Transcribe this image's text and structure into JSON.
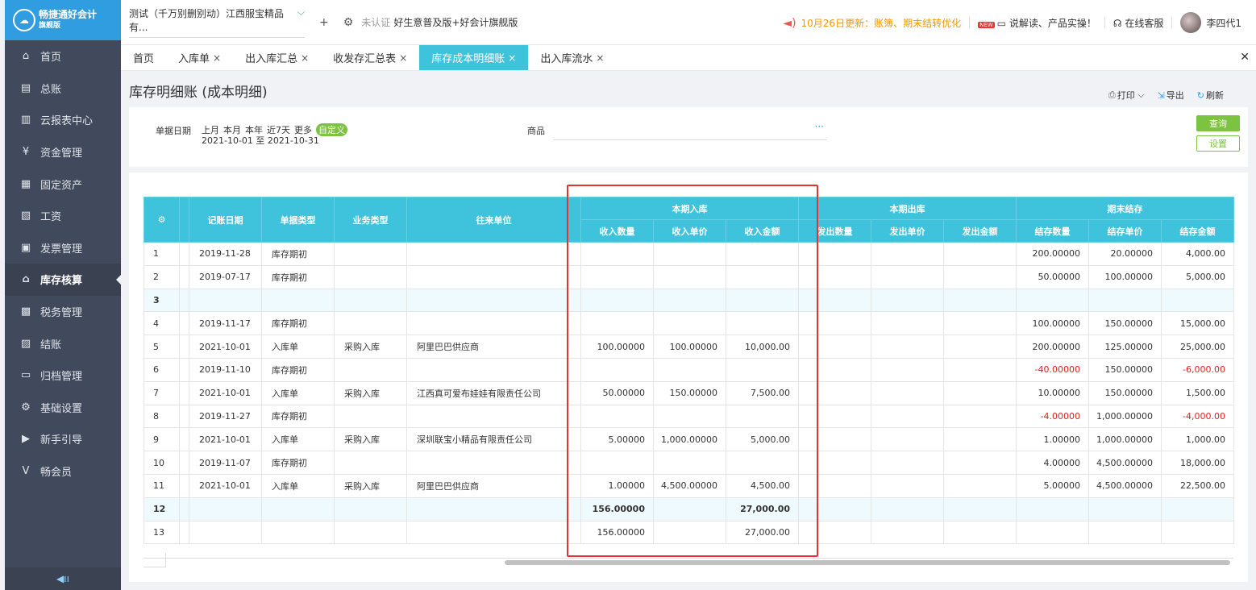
{
  "brand": {
    "name": "畅捷通好会计",
    "edition_badge": "旗舰版",
    "logo_glyph": "☁"
  },
  "sidebar": {
    "items": [
      {
        "label": "首页",
        "icon": "home-icon",
        "glyph": "⌂",
        "active": false
      },
      {
        "label": "总账",
        "icon": "ledger-icon",
        "glyph": "▤",
        "active": false
      },
      {
        "label": "云报表中心",
        "icon": "chart-icon",
        "glyph": "▥",
        "active": false
      },
      {
        "label": "资金管理",
        "icon": "money-icon",
        "glyph": "¥",
        "active": false
      },
      {
        "label": "固定资产",
        "icon": "asset-icon",
        "glyph": "▦",
        "active": false
      },
      {
        "label": "工资",
        "icon": "salary-icon",
        "glyph": "▧",
        "active": false
      },
      {
        "label": "发票管理",
        "icon": "invoice-icon",
        "glyph": "▣",
        "active": false
      },
      {
        "label": "库存核算",
        "icon": "warehouse-icon",
        "glyph": "⌂",
        "active": true
      },
      {
        "label": "税务管理",
        "icon": "tax-icon",
        "glyph": "▩",
        "active": false
      },
      {
        "label": "结账",
        "icon": "close-books-icon",
        "glyph": "▨",
        "active": false
      },
      {
        "label": "归档管理",
        "icon": "archive-icon",
        "glyph": "▭",
        "active": false
      },
      {
        "label": "基础设置",
        "icon": "gear-icon",
        "glyph": "⚙",
        "active": false
      },
      {
        "label": "新手引导",
        "icon": "guide-icon",
        "glyph": "▶",
        "active": false
      },
      {
        "label": "畅会员",
        "icon": "vip-icon",
        "glyph": "V",
        "active": false
      }
    ],
    "collapse_glyph": "◀ıı"
  },
  "topbar": {
    "company": "测试（千万别删别动）江西服宝精品有...",
    "company_chevron": "⌵",
    "add_glyph": "+",
    "settings_glyph": "⚙",
    "auth_status": "未认证",
    "edition": "好生意普及版+好会计旗舰版",
    "notice": "10月26日更新：账簿、期末结转优化",
    "tutorial_badge": "NEW",
    "tutorial": "说解读、产品实操！",
    "support": "在线客服",
    "user": "李四代1"
  },
  "tabs": [
    {
      "label": "首页",
      "closable": false,
      "active": false
    },
    {
      "label": "入库单",
      "closable": true,
      "active": false
    },
    {
      "label": "出入库汇总",
      "closable": true,
      "active": false
    },
    {
      "label": "收发存汇总表",
      "closable": true,
      "active": false
    },
    {
      "label": "库存成本明细账",
      "closable": true,
      "active": true
    },
    {
      "label": "出入库流水",
      "closable": true,
      "active": false
    }
  ],
  "page": {
    "title": "库存明细账 (成本明细)",
    "actions": {
      "print": "打印",
      "export": "导出",
      "refresh": "刷新"
    }
  },
  "filter": {
    "date_label": "单据日期",
    "quick_ranges": [
      "上月",
      "本月",
      "本年",
      "近7天",
      "更多"
    ],
    "custom_label": "自定义",
    "date_range": "2021-10-01 至 2021-10-31",
    "goods_label": "商品",
    "goods_value": "",
    "goods_more": "···",
    "query_button": "查询",
    "settings_button": "设置"
  },
  "table": {
    "settings_glyph": "⚙",
    "columns": {
      "date": "记账日期",
      "doc_type": "单据类型",
      "biz_type": "业务类型",
      "partner": "往来单位",
      "in_group": "本期入库",
      "out_group": "本期出库",
      "end_group": "期末结存",
      "in_qty": "收入数量",
      "in_price": "收入单价",
      "in_amount": "收入金额",
      "out_qty": "发出数量",
      "out_price": "发出单价",
      "out_amount": "发出金额",
      "end_qty": "结存数量",
      "end_price": "结存单价",
      "end_amount": "结存金额"
    },
    "rows": [
      {
        "idx": "1",
        "date": "2019-11-28",
        "doc_type": "库存期初",
        "biz_type": "",
        "partner": "",
        "in_qty": "",
        "in_price": "",
        "in_amount": "",
        "out_qty": "",
        "out_price": "",
        "out_amount": "",
        "end_qty": "200.00000",
        "end_price": "20.00000",
        "end_amount": "4,000.00",
        "negative": false,
        "highlight": false,
        "bold": false
      },
      {
        "idx": "2",
        "date": "2019-07-17",
        "doc_type": "库存期初",
        "biz_type": "",
        "partner": "",
        "in_qty": "",
        "in_price": "",
        "in_amount": "",
        "out_qty": "",
        "out_price": "",
        "out_amount": "",
        "end_qty": "50.00000",
        "end_price": "100.00000",
        "end_amount": "5,000.00",
        "negative": false,
        "highlight": false,
        "bold": false
      },
      {
        "idx": "3",
        "date": "",
        "doc_type": "",
        "biz_type": "",
        "partner": "",
        "in_qty": "",
        "in_price": "",
        "in_amount": "",
        "out_qty": "",
        "out_price": "",
        "out_amount": "",
        "end_qty": "",
        "end_price": "",
        "end_amount": "",
        "negative": false,
        "highlight": true,
        "bold": true
      },
      {
        "idx": "4",
        "date": "2019-11-17",
        "doc_type": "库存期初",
        "biz_type": "",
        "partner": "",
        "in_qty": "",
        "in_price": "",
        "in_amount": "",
        "out_qty": "",
        "out_price": "",
        "out_amount": "",
        "end_qty": "100.00000",
        "end_price": "150.00000",
        "end_amount": "15,000.00",
        "negative": false,
        "highlight": false,
        "bold": false
      },
      {
        "idx": "5",
        "date": "2021-10-01",
        "doc_type": "入库单",
        "biz_type": "采购入库",
        "partner": "阿里巴巴供应商",
        "in_qty": "100.00000",
        "in_price": "100.00000",
        "in_amount": "10,000.00",
        "out_qty": "",
        "out_price": "",
        "out_amount": "",
        "end_qty": "200.00000",
        "end_price": "125.00000",
        "end_amount": "25,000.00",
        "negative": false,
        "highlight": false,
        "bold": false
      },
      {
        "idx": "6",
        "date": "2019-11-10",
        "doc_type": "库存期初",
        "biz_type": "",
        "partner": "",
        "in_qty": "",
        "in_price": "",
        "in_amount": "",
        "out_qty": "",
        "out_price": "",
        "out_amount": "",
        "end_qty": "-40.00000",
        "end_price": "150.00000",
        "end_amount": "-6,000.00",
        "negative": true,
        "highlight": false,
        "bold": false
      },
      {
        "idx": "7",
        "date": "2021-10-01",
        "doc_type": "入库单",
        "biz_type": "采购入库",
        "partner": "江西真可爱布娃娃有限责任公司",
        "in_qty": "50.00000",
        "in_price": "150.00000",
        "in_amount": "7,500.00",
        "out_qty": "",
        "out_price": "",
        "out_amount": "",
        "end_qty": "10.00000",
        "end_price": "150.00000",
        "end_amount": "1,500.00",
        "negative": false,
        "highlight": false,
        "bold": false
      },
      {
        "idx": "8",
        "date": "2019-11-27",
        "doc_type": "库存期初",
        "biz_type": "",
        "partner": "",
        "in_qty": "",
        "in_price": "",
        "in_amount": "",
        "out_qty": "",
        "out_price": "",
        "out_amount": "",
        "end_qty": "-4.00000",
        "end_price": "1,000.00000",
        "end_amount": "-4,000.00",
        "negative": true,
        "highlight": false,
        "bold": false
      },
      {
        "idx": "9",
        "date": "2021-10-01",
        "doc_type": "入库单",
        "biz_type": "采购入库",
        "partner": "深圳联宝小精品有限责任公司",
        "in_qty": "5.00000",
        "in_price": "1,000.00000",
        "in_amount": "5,000.00",
        "out_qty": "",
        "out_price": "",
        "out_amount": "",
        "end_qty": "1.00000",
        "end_price": "1,000.00000",
        "end_amount": "1,000.00",
        "negative": false,
        "highlight": false,
        "bold": false
      },
      {
        "idx": "10",
        "date": "2019-11-07",
        "doc_type": "库存期初",
        "biz_type": "",
        "partner": "",
        "in_qty": "",
        "in_price": "",
        "in_amount": "",
        "out_qty": "",
        "out_price": "",
        "out_amount": "",
        "end_qty": "4.00000",
        "end_price": "4,500.00000",
        "end_amount": "18,000.00",
        "negative": false,
        "highlight": false,
        "bold": false
      },
      {
        "idx": "11",
        "date": "2021-10-01",
        "doc_type": "入库单",
        "biz_type": "采购入库",
        "partner": "阿里巴巴供应商",
        "in_qty": "1.00000",
        "in_price": "4,500.00000",
        "in_amount": "4,500.00",
        "out_qty": "",
        "out_price": "",
        "out_amount": "",
        "end_qty": "5.00000",
        "end_price": "4,500.00000",
        "end_amount": "22,500.00",
        "negative": false,
        "highlight": false,
        "bold": false
      },
      {
        "idx": "12",
        "date": "",
        "doc_type": "",
        "biz_type": "",
        "partner": "",
        "in_qty": "156.00000",
        "in_price": "",
        "in_amount": "27,000.00",
        "out_qty": "",
        "out_price": "",
        "out_amount": "",
        "end_qty": "",
        "end_price": "",
        "end_amount": "",
        "negative": false,
        "highlight": true,
        "bold": true
      },
      {
        "idx": "13",
        "date": "",
        "doc_type": "",
        "biz_type": "",
        "partner": "",
        "in_qty": "156.00000",
        "in_price": "",
        "in_amount": "27,000.00",
        "out_qty": "",
        "out_price": "",
        "out_amount": "",
        "end_qty": "",
        "end_price": "",
        "end_amount": "",
        "negative": false,
        "highlight": false,
        "bold": false
      }
    ]
  },
  "colors": {
    "sidebar_bg": "#414a5c",
    "accent_teal": "#3fc3dc",
    "brand_blue": "#2f9de0",
    "action_green": "#7bc341",
    "negative_red": "#e02020",
    "highlight_box": "#e33434",
    "notice_orange": "#f39800"
  }
}
